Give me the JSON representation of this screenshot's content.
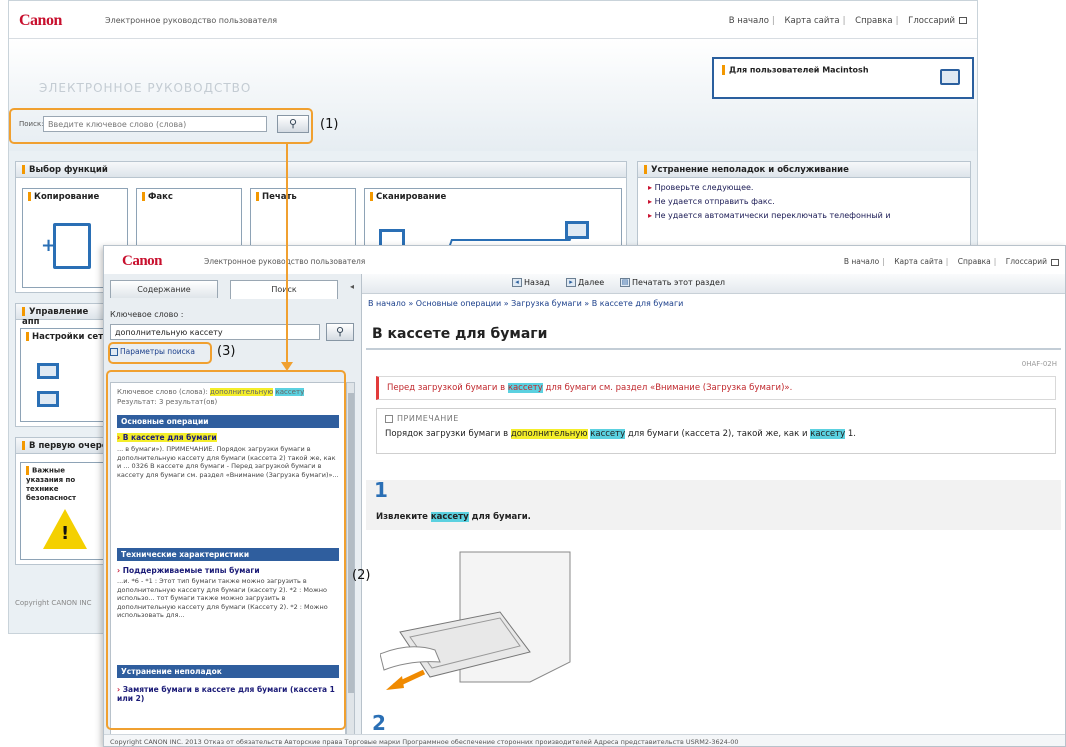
{
  "brand": "Canon",
  "header_title": "Электронное руководство пользователя",
  "header_links": [
    "В начало",
    "Карта сайта",
    "Справка",
    "Глоссарий"
  ],
  "bg": {
    "hero_title": "ЭЛЕКТРОННОЕ РУКОВОДСТВО",
    "mac_label": "Для пользователей Macintosh",
    "search_label": "Поиск:",
    "search_placeholder": "Введите ключевое слово (слова)",
    "functions_header": "Выбор функций",
    "tiles": [
      "Копирование",
      "Факс",
      "Печать",
      "Сканирование"
    ],
    "trouble_header": "Устранение неполадок и обслуживание",
    "trouble_items": [
      "Проверьте следующее.",
      "Не удается отправить факс.",
      "Не удается автоматически переключать телефонный и"
    ],
    "mgmt_header": "Управление апп",
    "net_tile": "Настройки сет",
    "first_header": "В первую очере",
    "safety_tile": "Важные указания по технике безопасност",
    "copyright": "Copyright CANON INC"
  },
  "fg": {
    "tabs": [
      "Содержание",
      "Поиск"
    ],
    "keyword_label": "Ключевое слово :",
    "keyword_value": "дополнительную кассету",
    "search_options": "Параметры поиска",
    "results_meta_1": "Ключевое слово (слова):",
    "results_meta_kw1": "дополнительную",
    "results_meta_kw2": "кассету",
    "results_meta_2": "Результат: 3 результат(ов)",
    "categories": [
      "Основные операции",
      "Технические характеристики",
      "Устранение неполадок"
    ],
    "results": [
      {
        "title": "В кассете для бумаги",
        "body": "... в бумаги»). ПРИМЕЧАНИЕ. Порядок загрузки бумаги в дополнительную кассету для бумаги (кассета 2) такой же, как и ... 0326 В кассете для бумаги - Перед загрузкой бумаги в кассету для бумаги см. раздел «Внимание (Загрузка бумаги)»..."
      },
      {
        "title": "Поддерживаемые типы бумаги",
        "body": "...и. *6 - *1 : Этот тип бумаги также можно загрузить в дополнительную кассету для бумаги (кассету 2). *2 : Можно использо... тот бумаги также можно загрузить в дополнительную кассету для бумаги (Кассету 2). *2 : Можно использовать для..."
      },
      {
        "title": "Замятие бумаги в кассете для бумаги (кассета 1 или 2)",
        "body": ""
      }
    ],
    "toolbar": [
      "Назад",
      "Далее",
      "Печатать этот раздел"
    ],
    "breadcrumb": "В начало » Основные операции » Загрузка бумаги » В кассете для бумаги",
    "page_title": "В кассете для бумаги",
    "doc_id": "0HAF-02H",
    "caution_pre": "Перед загрузкой бумаги в",
    "caution_hl": "кассету",
    "caution_post": "для бумаги см. раздел «Внимание (Загрузка бумаги)».",
    "note_header": "ПРИМЕЧАНИЕ",
    "note_pre": "Порядок загрузки бумаги в",
    "note_hl1": "дополнительную",
    "note_hl2": "кассету",
    "note_mid": "для бумаги (кассета 2), такой же, как и",
    "note_hl3": "кассету",
    "note_post": "1.",
    "step1_num": "1",
    "step1_pre": "Извлеките",
    "step1_hl": "кассету",
    "step1_post": "для бумаги.",
    "step2_num": "2",
    "footer": "Copyright CANON INC. 2013     Отказ от обязательств     Авторские права     Торговые марки     Программное обеспечение сторонних производителей     Адреса представительств     USRM2-3624-00"
  },
  "callouts": [
    "(1)",
    "(2)",
    "(3)"
  ],
  "colors": {
    "brand_red": "#c8102e",
    "accent_orange": "#f0a030",
    "link_blue": "#2f5e9e",
    "highlight_yellow": "#f4ee2a",
    "highlight_cyan": "#5bd1e0"
  }
}
